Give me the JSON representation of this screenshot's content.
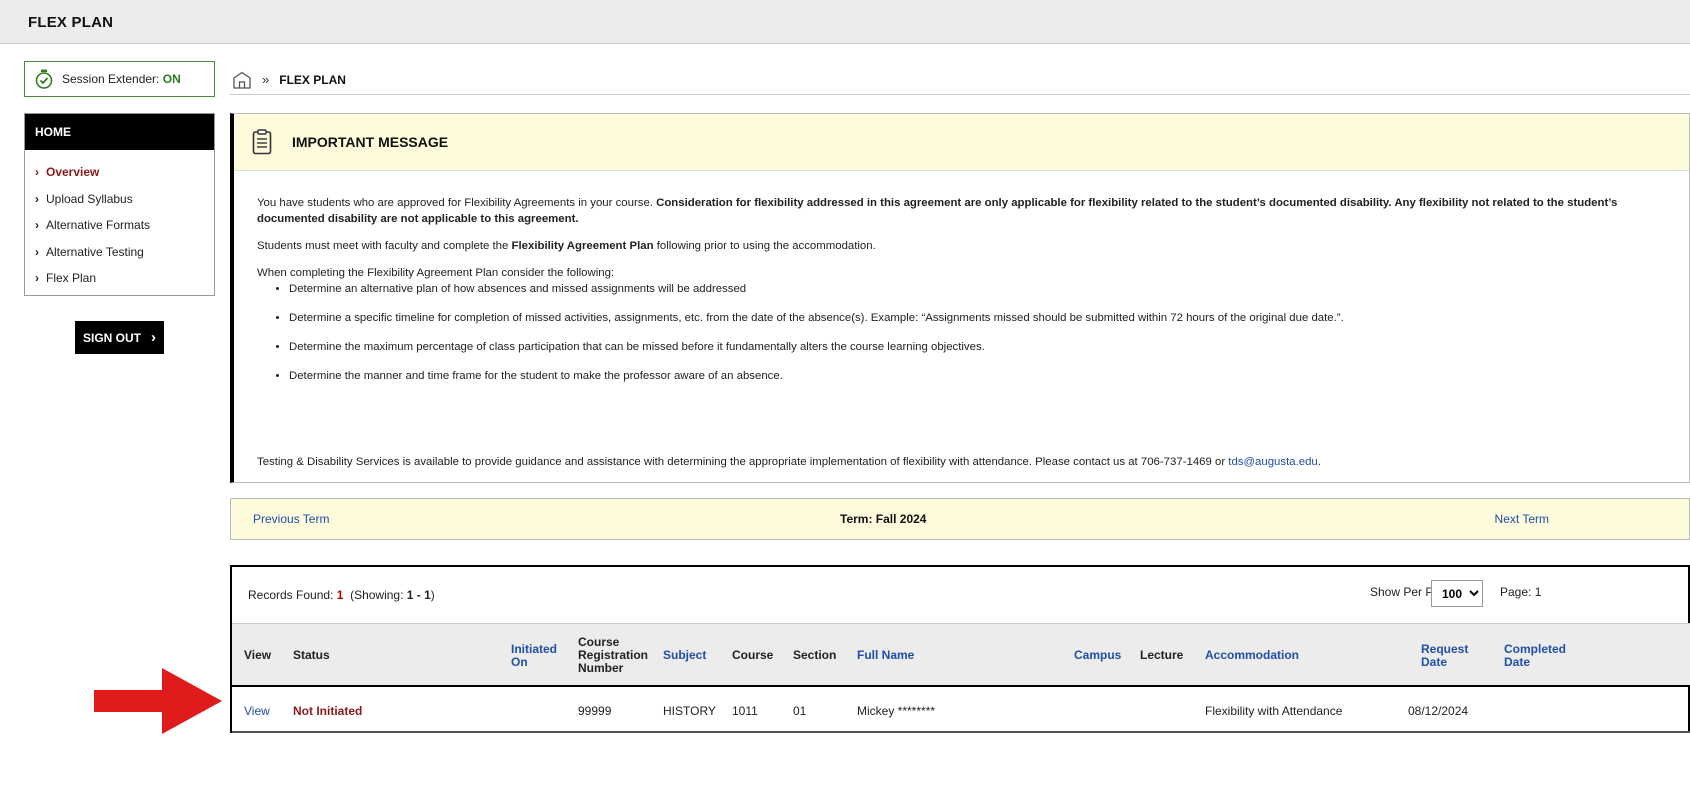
{
  "app": {
    "title": "FLEX PLAN"
  },
  "session": {
    "label": "Session Extender: ",
    "status": "ON"
  },
  "sidebar": {
    "heading": "HOME",
    "items": [
      {
        "label": "Overview",
        "active": true
      },
      {
        "label": "Upload Syllabus",
        "active": false
      },
      {
        "label": "Alternative Formats",
        "active": false
      },
      {
        "label": "Alternative Testing",
        "active": false
      },
      {
        "label": "Flex Plan",
        "active": false
      }
    ],
    "signout_label": "SIGN OUT"
  },
  "breadcrumb": {
    "separator": "»",
    "current": "FLEX PLAN"
  },
  "message": {
    "title": "IMPORTANT MESSAGE",
    "p1_normal": "You have students who are approved for Flexibility Agreements in your course. ",
    "p1_bold": "Consideration for flexibility addressed in this agreement are only applicable for flexibility related to the student’s documented disability. Any flexibility not related to the student’s documented disability are not applicable to this agreement.",
    "p2_a": "Students must meet with faculty and complete the ",
    "p2_bold": "Flexibility Agreement Plan",
    "p2_b": " following prior to using the accommodation.",
    "p3": "When completing the Flexibility Agreement Plan consider the following:",
    "bullets": [
      "Determine an alternative plan of how absences and missed assignments will be addressed",
      "Determine a specific timeline for completion of missed activities, assignments, etc. from the date of the absence(s). Example: “Assignments missed should be submitted within 72 hours of the original due date.”.",
      "Determine the maximum percentage of class participation that can be missed before it fundamentally alters the course learning objectives.",
      "Determine the manner and time frame for the student to make the professor aware of an absence."
    ],
    "contact_text": "Testing & Disability Services is available to provide guidance and assistance with determining the appropriate implementation of flexibility with attendance. Please contact us at 706-737-1469 or ",
    "contact_email": "tds@augusta.edu",
    "contact_end": "."
  },
  "term": {
    "prev_label": "Previous Term",
    "current": "Term: Fall 2024",
    "next_label": "Next Term"
  },
  "records": {
    "found_label": "Records Found: ",
    "found_count": "1",
    "showing_label": "(Showing: ",
    "showing_range": "1 - 1",
    "showing_end": ")",
    "per_page_label": "Show Per Page:",
    "per_page_value": "100",
    "page_label": "Page: 1"
  },
  "table": {
    "headers": {
      "view": "View",
      "status": "Status",
      "initiated_on": "Initiated On",
      "crn": "Course Registration Number",
      "subject": "Subject",
      "course": "Course",
      "section": "Section",
      "full_name": "Full Name",
      "campus": "Campus",
      "lecture": "Lecture",
      "accommodation": "Accommodation",
      "request_date": "Request Date",
      "completed_date": "Completed Date"
    },
    "rows": [
      {
        "view": "View",
        "status": "Not Initiated",
        "initiated_on": "",
        "crn": "99999",
        "subject": "HISTORY",
        "course": "1011",
        "section": "01",
        "full_name": "Mickey ********",
        "campus": "",
        "lecture": "",
        "accommodation": "Flexibility with Attendance",
        "request_date": "08/12/2024",
        "completed_date": ""
      }
    ]
  },
  "colors": {
    "link": "#1f4fa8",
    "status_red": "#8b1a1a",
    "message_bg": "#fdfbdc",
    "session_green": "#2e7d1f",
    "arrow_red": "#e01b1b"
  }
}
